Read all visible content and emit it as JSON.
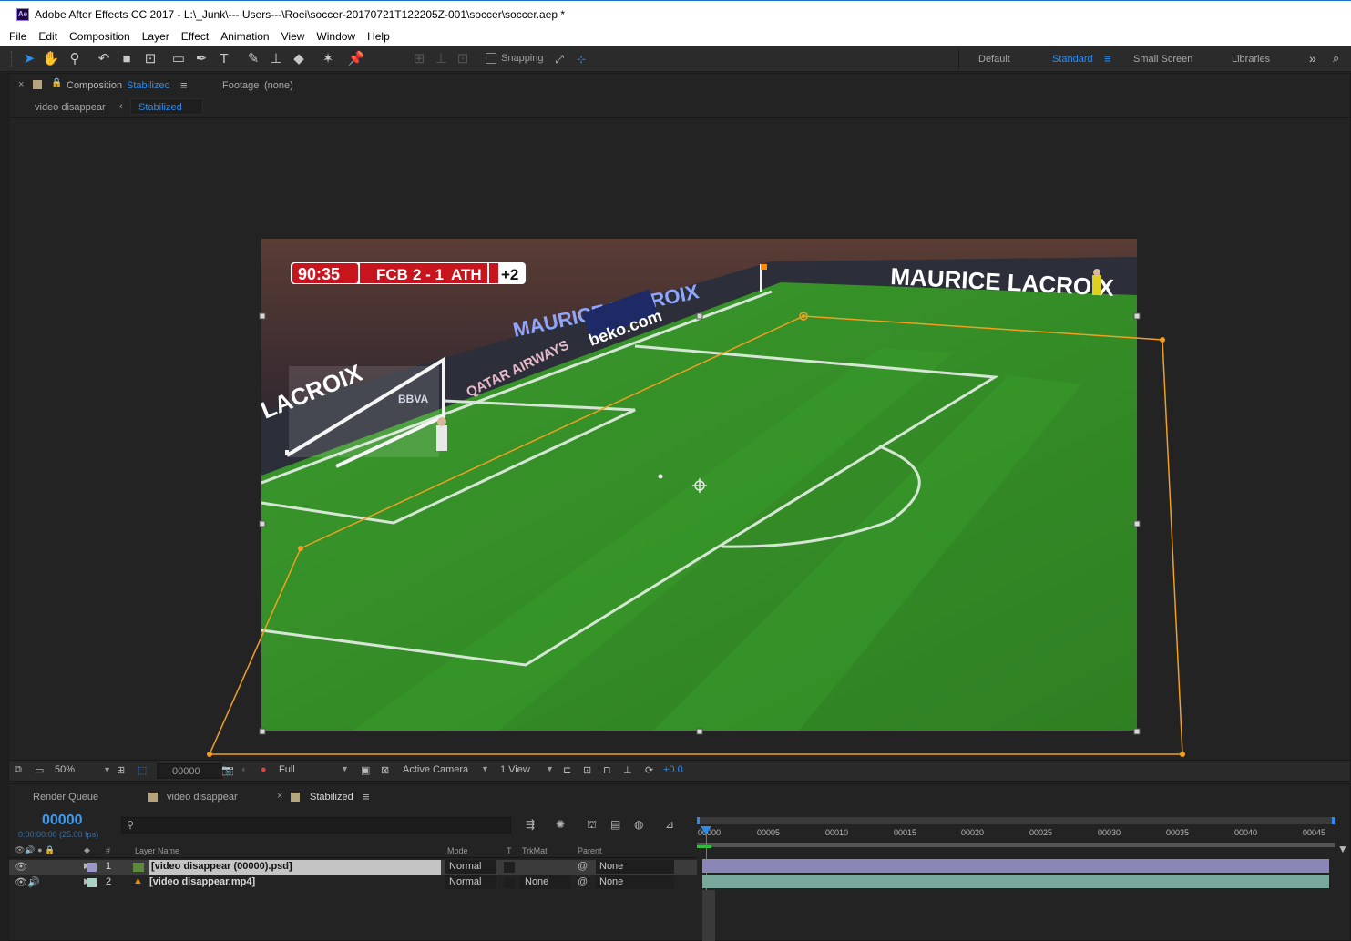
{
  "window": {
    "title": "Adobe After Effects CC 2017 - L:\\_Junk\\--- Users---\\Roei\\soccer-20170721T122205Z-001\\soccer\\soccer.aep *",
    "app_icon": "Ae"
  },
  "menu": [
    "File",
    "Edit",
    "Composition",
    "Layer",
    "Effect",
    "Animation",
    "View",
    "Window",
    "Help"
  ],
  "toolbar": {
    "snapping_label": "Snapping",
    "workspaces": [
      "Default",
      "Standard",
      "Small Screen",
      "Libraries"
    ],
    "active_workspace": "Standard",
    "more_icon": "chevron-double-right-icon"
  },
  "comp_panel": {
    "tab_prefix": "Composition",
    "tab_name": "Stabilized",
    "footage_tab": "Footage",
    "footage_value": "(none)",
    "flow_items": [
      "video disappear",
      "Stabilized"
    ],
    "scoreboard": {
      "time": "90:35",
      "home": "FCB",
      "score": "2 - 1",
      "away": "ATH",
      "extra": "+2"
    },
    "billboards": [
      "MAURICE LACROIX",
      "MAURICE LACROIX",
      "beko.com",
      "QATAR AIRWAYS",
      "LACROIX",
      "BBVA"
    ],
    "footer": {
      "zoom": "50%",
      "timecode": "00000",
      "resolution": "Full",
      "camera": "Active Camera",
      "views": "1 View",
      "exposure": "+0.0"
    }
  },
  "timeline": {
    "tabs": [
      "Render Queue",
      "video disappear",
      "Stabilized"
    ],
    "active_tab": "Stabilized",
    "timecode": "00000",
    "fps_label": "0:00:00:00 (25.00 fps)",
    "search_placeholder": "",
    "columns": [
      "#",
      "Layer Name",
      "Mode",
      "T",
      "TrkMat",
      "Parent"
    ],
    "layers": [
      {
        "num": "1",
        "name": "[video disappear (00000).psd]",
        "mode": "Normal",
        "trkmat": "",
        "parent": "None",
        "color": "#9a96c8"
      },
      {
        "num": "2",
        "name": "[video disappear.mp4]",
        "mode": "Normal",
        "trkmat": "None",
        "parent": "None",
        "color": "#a8d2c4"
      }
    ],
    "ruler_ticks": [
      "00000",
      "00005",
      "00010",
      "00015",
      "00020",
      "00025",
      "00030",
      "00035",
      "00040",
      "00045"
    ]
  },
  "colors": {
    "accent": "#2d8ceb",
    "mask_path": "#f0a020",
    "pitch": "#2f8a25"
  }
}
